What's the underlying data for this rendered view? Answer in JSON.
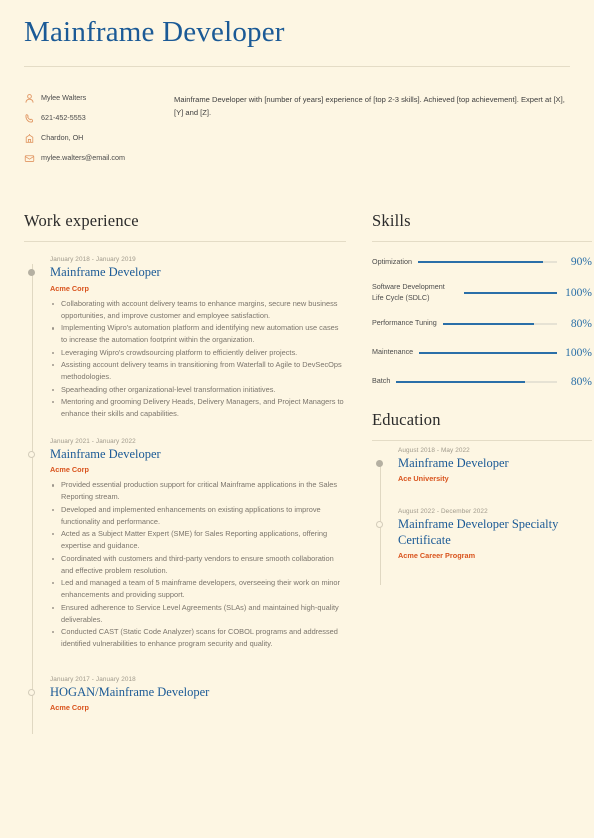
{
  "header": {
    "title": "Mainframe Developer",
    "contacts": [
      {
        "icon": "person-icon",
        "text": "Mylee Walters"
      },
      {
        "icon": "phone-icon",
        "text": "621-452-5553"
      },
      {
        "icon": "location-building-icon",
        "text": "Chardon, OH"
      },
      {
        "icon": "mail-icon",
        "text": "mylee.walters@email.com"
      }
    ],
    "summary": "Mainframe Developer with [number of years] experience of [top 2-3 skills]. Achieved [top achievement]. Expert at [X], [Y] and [Z]."
  },
  "work": {
    "heading": "Work experience",
    "items": [
      {
        "date": "January 2018 - January 2019",
        "title": "Mainframe Developer",
        "org": "Acme Corp",
        "marker": "filled",
        "bullets": [
          "Collaborating with account delivery teams to enhance margins, secure new business opportunities, and improve customer and employee satisfaction.",
          "Implementing Wipro's automation platform and identifying new automation use cases to increase the automation footprint within the organization.",
          "Leveraging Wipro's crowdsourcing platform to efficiently deliver projects.",
          "Assisting account delivery teams in transitioning from Waterfall to Agile to DevSecOps methodologies.",
          "Spearheading other organizational-level transformation initiatives.",
          "Mentoring and grooming Delivery Heads, Delivery Managers, and Project Managers to enhance their skills and capabilities."
        ]
      },
      {
        "date": "January 2021 - January 2022",
        "title": "Mainframe Developer",
        "org": "Acme Corp",
        "marker": "hollow",
        "bullets": [
          "Provided essential production support for critical Mainframe applications in the Sales Reporting stream.",
          "Developed and implemented enhancements on existing applications to improve functionality and performance.",
          "Acted as a Subject Matter Expert (SME) for Sales Reporting applications, offering expertise and guidance.",
          "Coordinated with customers and third-party vendors to ensure smooth collaboration and effective problem resolution.",
          "Led and managed a team of 5 mainframe developers, overseeing their work on minor enhancements and providing support.",
          "Ensured adherence to Service Level Agreements (SLAs) and maintained high-quality deliverables.",
          "Conducted CAST (Static Code Analyzer) scans for COBOL programs and addressed identified vulnerabilities to enhance program security and quality."
        ]
      },
      {
        "date": "January 2017 - January 2018",
        "title": "HOGAN/Mainframe Developer",
        "org": "Acme Corp",
        "marker": "hollow",
        "bullets": []
      }
    ]
  },
  "skills": {
    "heading": "Skills",
    "items": [
      {
        "name": "Optimization",
        "percent_label": "90%",
        "percent": 90
      },
      {
        "name": "Software Development Life Cycle (SDLC)",
        "percent_label": "100%",
        "percent": 100
      },
      {
        "name": "Performance Tuning",
        "percent_label": "80%",
        "percent": 80
      },
      {
        "name": "Maintenance",
        "percent_label": "100%",
        "percent": 100
      },
      {
        "name": "Batch",
        "percent_label": "80%",
        "percent": 80
      }
    ]
  },
  "education": {
    "heading": "Education",
    "items": [
      {
        "date": "August 2018 - May 2022",
        "title": "Mainframe Developer",
        "org": "Ace University",
        "marker": "filled"
      },
      {
        "date": "August 2022 - December 2022",
        "title": "Mainframe Developer Specialty Certificate",
        "org": "Acme Career Program",
        "marker": "hollow"
      }
    ]
  },
  "colors": {
    "background": "#fdf6e3",
    "heading_blue": "#1b5a96",
    "accent_orange": "#d9541e",
    "icon_orange": "#e09561",
    "bar_blue": "#2a6fa8",
    "rule": "#e4dcc6"
  }
}
